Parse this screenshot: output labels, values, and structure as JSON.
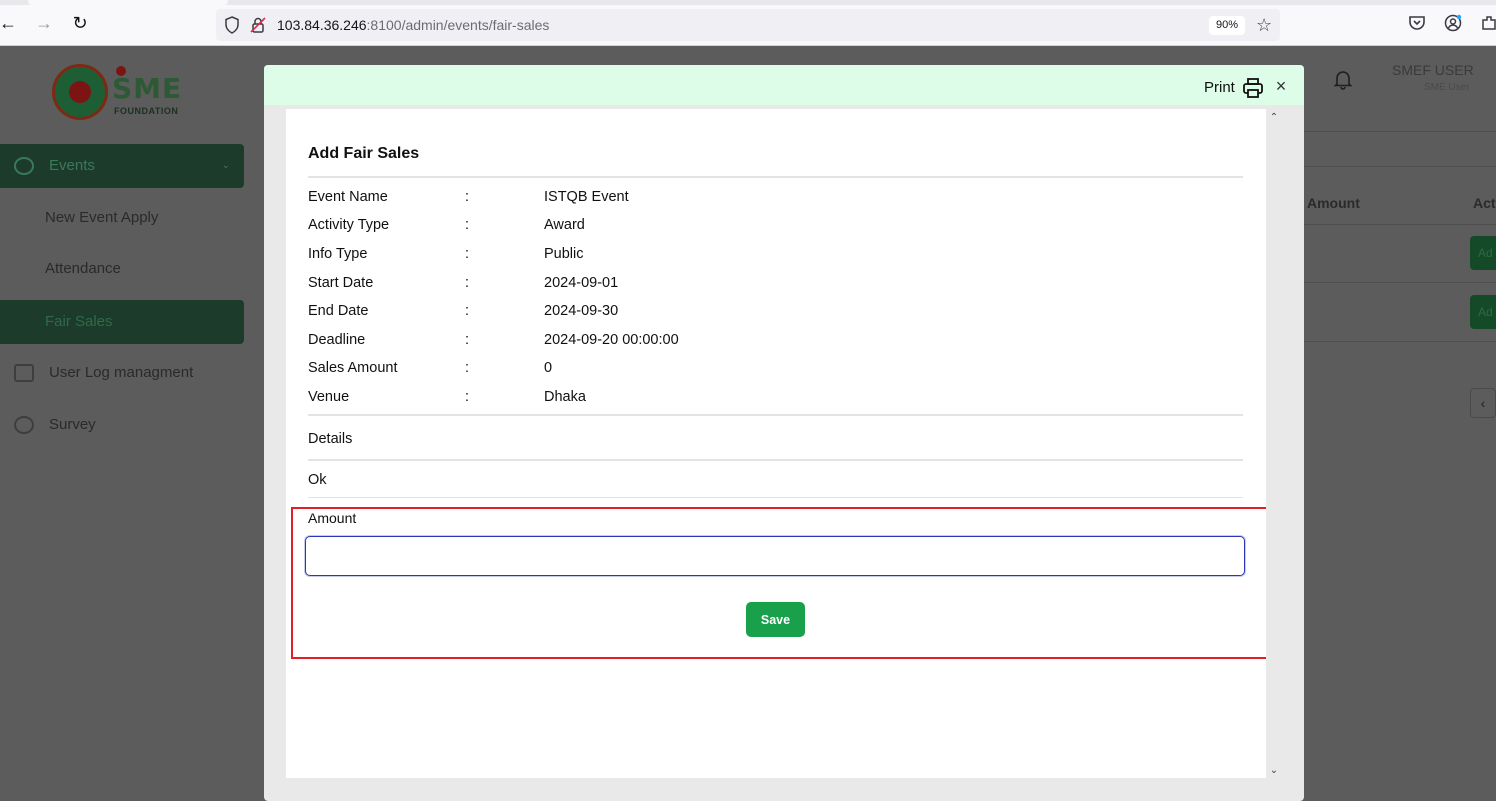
{
  "browser": {
    "url_host": "103.84.36.246",
    "url_rest": ":8100/admin/events/fair-sales",
    "zoom": "90%"
  },
  "sidebar": {
    "items": [
      {
        "label": "Events",
        "icon": "events-icon"
      },
      {
        "label": "New Event Apply"
      },
      {
        "label": "Attendance"
      },
      {
        "label": "Fair Sales"
      },
      {
        "label": "User Log managment",
        "icon": "user-log-icon"
      },
      {
        "label": "Survey",
        "icon": "survey-icon"
      }
    ]
  },
  "header": {
    "user_name": "SMEF USER",
    "user_role": "SME User"
  },
  "background_table": {
    "col_amount": "Amount",
    "col_action": "Act",
    "action_label": "Ad"
  },
  "modal": {
    "print_label": "Print",
    "title": "Add Fair Sales",
    "separator": ":",
    "fields": [
      {
        "label": "Event Name",
        "value": "ISTQB Event"
      },
      {
        "label": "Activity Type",
        "value": "Award"
      },
      {
        "label": "Info Type",
        "value": "Public"
      },
      {
        "label": "Start Date",
        "value": "2024-09-01"
      },
      {
        "label": "End Date",
        "value": "2024-09-30"
      },
      {
        "label": "Deadline",
        "value": "2024-09-20 00:00:00"
      },
      {
        "label": "Sales Amount",
        "value": "0"
      },
      {
        "label": "Venue",
        "value": "Dhaka"
      }
    ],
    "details_label": "Details",
    "ok_label": "Ok",
    "amount_label": "Amount",
    "amount_value": "",
    "amount_placeholder": "",
    "save_label": "Save"
  },
  "colors": {
    "modal_header_bg": "#ddfde9",
    "save_button": "#18a04a",
    "highlight_border": "#e51c23",
    "input_focus_border": "#2a37b8"
  }
}
